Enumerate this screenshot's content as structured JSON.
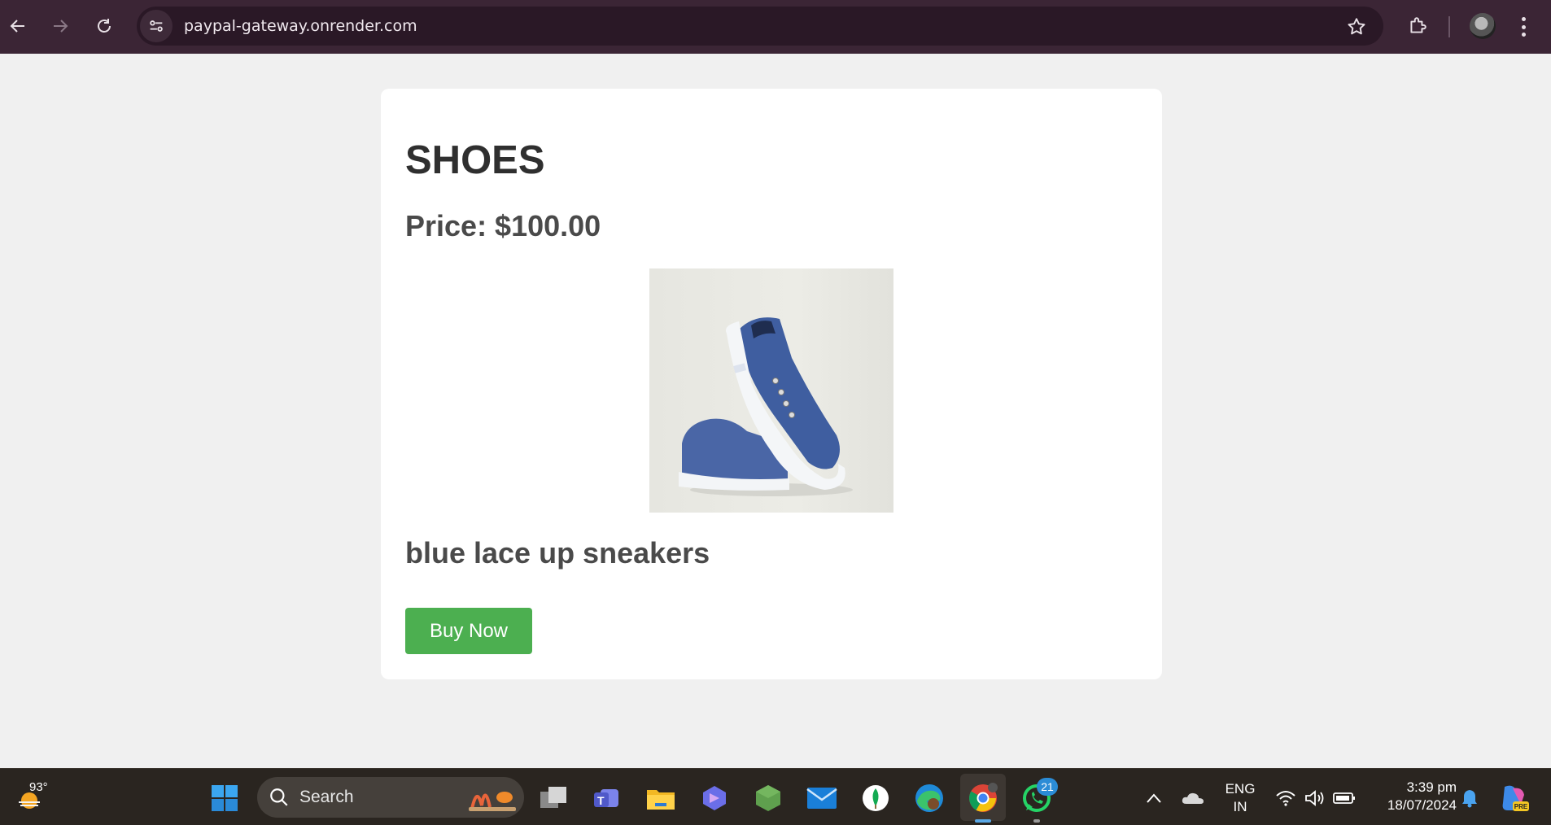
{
  "browser": {
    "url": "paypal-gateway.onrender.com",
    "icons": {
      "back": "back-arrow-icon",
      "forward": "forward-arrow-icon",
      "reload": "reload-icon",
      "site_info": "site-settings-icon",
      "bookmark": "star-icon",
      "extensions": "puzzle-icon",
      "menu": "kebab-menu-icon"
    }
  },
  "product": {
    "title": "SHOES",
    "price": "Price: $100.00",
    "image_alt": "blue lace up sneakers",
    "description": "blue lace up sneakers",
    "button_label": "Buy Now"
  },
  "colors": {
    "buy_button": "#4caf50",
    "browser_bar": "#3b2535",
    "page_bg": "#f0f0f0"
  },
  "taskbar": {
    "weather_temp": "93°",
    "search_label": "Search",
    "language_line1": "ENG",
    "language_line2": "IN",
    "time": "3:39 pm",
    "date": "18/07/2024",
    "whatsapp_badge": "21",
    "copilot_badge": "PRE",
    "apps": [
      "windows-start-icon",
      "task-view-icon",
      "teams-icon",
      "file-explorer-icon",
      "copilot-app-icon",
      "nodejs-icon",
      "mail-icon",
      "mongodb-icon",
      "edge-icon",
      "chrome-icon",
      "whatsapp-icon"
    ]
  }
}
